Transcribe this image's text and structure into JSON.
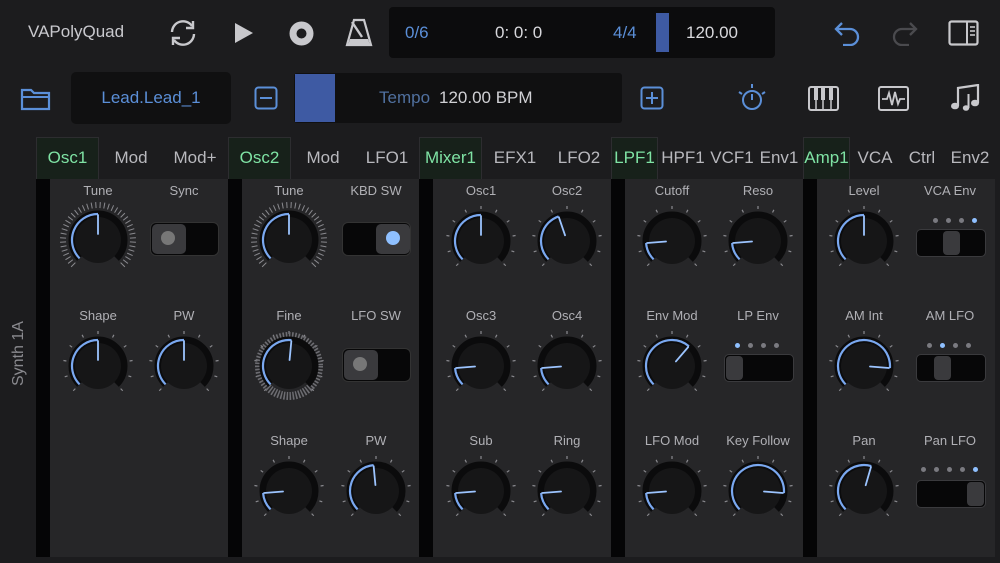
{
  "app": {
    "title": "VAPolyQuad"
  },
  "transport": {
    "pattern": "0/6",
    "time": "0: 0: 0",
    "signature": "4/4",
    "bpm": "120.00"
  },
  "preset": {
    "name": "Lead.Lead_1"
  },
  "tempo": {
    "label": "Tempo",
    "value": "120.00 BPM"
  },
  "side_label": "Synth 1A",
  "tabs": [
    {
      "label": "Osc1",
      "active": true
    },
    {
      "label": "Mod"
    },
    {
      "label": "Mod+"
    },
    {
      "label": "Osc2",
      "active": true
    },
    {
      "label": "Mod"
    },
    {
      "label": "LFO1"
    },
    {
      "label": "Mixer1",
      "active": true
    },
    {
      "label": "EFX1"
    },
    {
      "label": "LFO2"
    },
    {
      "label": "LPF1",
      "active": true
    },
    {
      "label": "HPF1"
    },
    {
      "label": "VCF1"
    },
    {
      "label": "Env1"
    },
    {
      "label": "Amp1",
      "active": true
    },
    {
      "label": "VCA"
    },
    {
      "label": "Ctrl"
    },
    {
      "label": "Env2"
    }
  ],
  "panels": {
    "osc1": {
      "tune": "Tune",
      "sync": "Sync",
      "shape": "Shape",
      "pw": "PW",
      "values": {
        "tune": 0.5,
        "shape": 0.5,
        "pw": 0.5
      },
      "sync_on": false
    },
    "osc2": {
      "tune": "Tune",
      "kbd_sw": "KBD SW",
      "fine": "Fine",
      "lfo_sw": "LFO SW",
      "shape": "Shape",
      "pw": "PW",
      "values": {
        "tune": 0.5,
        "fine": 0.52,
        "shape": 0.15,
        "pw": 0.48
      },
      "kbd_sw_on": true,
      "lfo_sw_on": false
    },
    "mixer1": {
      "osc1": "Osc1",
      "osc2": "Osc2",
      "osc3": "Osc3",
      "osc4": "Osc4",
      "sub": "Sub",
      "ring": "Ring",
      "values": {
        "osc1": 0.5,
        "osc2": 0.43,
        "osc3": 0.15,
        "osc4": 0.15,
        "sub": 0.15,
        "ring": 0.15
      }
    },
    "lpf1": {
      "cutoff": "Cutoff",
      "reso": "Reso",
      "env_mod": "Env Mod",
      "lp_env": "LP Env",
      "lfo_mod": "LFO Mod",
      "key_follow": "Key Follow",
      "values": {
        "cutoff": 0.15,
        "reso": 0.15,
        "env_mod": 0.65,
        "lfo_mod": 0.15,
        "key_follow": 0.85
      },
      "lp_env_index": 0
    },
    "amp1": {
      "level": "Level",
      "vca_env": "VCA Env",
      "am_int": "AM Int",
      "am_lfo": "AM LFO",
      "pan": "Pan",
      "pan_lfo": "Pan LFO",
      "values": {
        "level": 0.5,
        "am_int": 0.85,
        "pan": 0.56
      },
      "vca_env_index": 3,
      "am_lfo_index": 1,
      "pan_lfo_index": 4
    }
  },
  "colors": {
    "accent": "#5b8fd8",
    "active_tab": "#7fe3a4",
    "knob_arc": "#7aa8f0"
  }
}
